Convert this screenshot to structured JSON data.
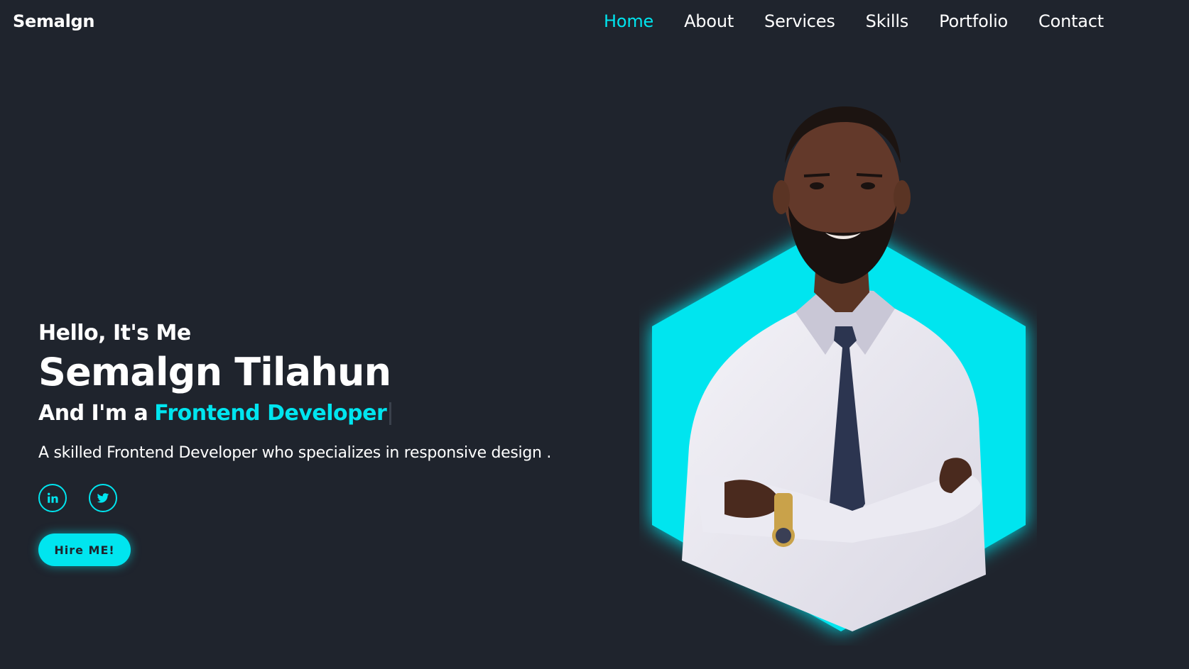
{
  "header": {
    "logo": "Semalgn",
    "nav": [
      {
        "label": "Home",
        "active": true
      },
      {
        "label": "About",
        "active": false
      },
      {
        "label": "Services",
        "active": false
      },
      {
        "label": "Skills",
        "active": false
      },
      {
        "label": "Portfolio",
        "active": false
      },
      {
        "label": "Contact",
        "active": false
      }
    ]
  },
  "hero": {
    "greeting": "Hello, It's Me",
    "name": "Semalgn Tilahun",
    "role_prefix": "And I'm a",
    "role_highlight": "Frontend Developer",
    "description": "A skilled Frontend Developer who specializes in responsive design .",
    "socials": [
      {
        "icon": "linkedin-icon"
      },
      {
        "icon": "twitter-icon"
      }
    ],
    "cta_label": "Hire ME!"
  },
  "colors": {
    "background": "#1f242d",
    "accent": "#00e5ef",
    "text": "#ffffff"
  }
}
